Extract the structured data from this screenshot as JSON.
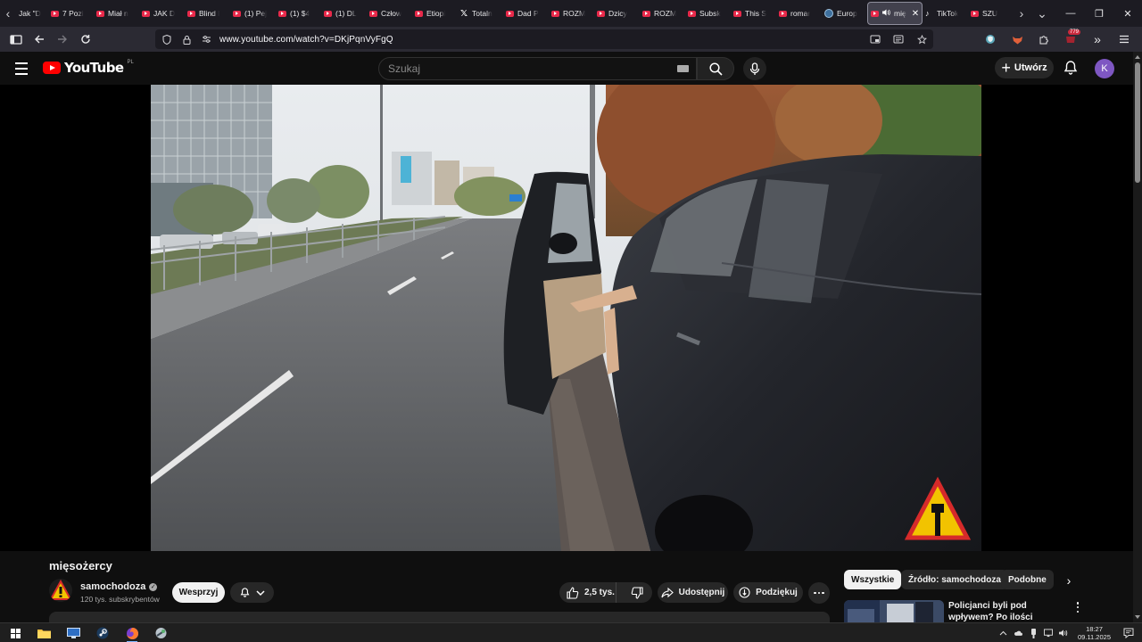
{
  "browser": {
    "tabs": [
      {
        "title": "Jak \"D",
        "icon": "tab-arrow-icon"
      },
      {
        "title": "7 Pozi",
        "icon": "youtube-favicon"
      },
      {
        "title": "Miał n",
        "icon": "youtube-favicon"
      },
      {
        "title": "JAK D",
        "icon": "youtube-favicon"
      },
      {
        "title": "Blind l",
        "icon": "youtube-favicon"
      },
      {
        "title": "(1) Pej",
        "icon": "youtube-favicon"
      },
      {
        "title": "(1) $4",
        "icon": "youtube-favicon"
      },
      {
        "title": "(1) DL",
        "icon": "youtube-favicon"
      },
      {
        "title": "Człow",
        "icon": "youtube-favicon"
      },
      {
        "title": "Etiopi",
        "icon": "youtube-favicon"
      },
      {
        "title": "Totaln",
        "icon": "x-favicon"
      },
      {
        "title": "Dad P",
        "icon": "youtube-favicon"
      },
      {
        "title": "ROZM",
        "icon": "youtube-favicon"
      },
      {
        "title": "Dzicy",
        "icon": "youtube-favicon"
      },
      {
        "title": "ROZM",
        "icon": "youtube-favicon"
      },
      {
        "title": "Subsk",
        "icon": "youtube-favicon"
      },
      {
        "title": "This S",
        "icon": "youtube-favicon"
      },
      {
        "title": "romar",
        "icon": "youtube-favicon"
      },
      {
        "title": "Europ",
        "icon": "globe-favicon"
      }
    ],
    "active_tab": {
      "title": "mię",
      "icon": "youtube-favicon"
    },
    "tabs_after": [
      {
        "title": "TikTok",
        "icon": "tiktok-favicon"
      },
      {
        "title": "SZU",
        "icon": "youtube-favicon"
      }
    ],
    "url": "www.youtube.com/watch?v=DKjPqnVyFgQ",
    "extension_badge": "779",
    "accent_color": "#e8294a"
  },
  "youtube": {
    "logo_text": "YouTube",
    "country_code": "PL",
    "search_placeholder": "Szukaj",
    "create_label": "Utwórz",
    "avatar_letter": "K",
    "avatar_color": "#7e57c2",
    "video": {
      "title": "mięsożercy",
      "channel_name": "samochodoza",
      "subscribers": "120 tys. subskrybentów",
      "support_label": "Wesprzyj",
      "like_count": "2,5 tys.",
      "share_label": "Udostępnij",
      "thanks_label": "Podziękuj"
    },
    "chips": [
      "Wszystkie",
      "Źródło: samochodoza",
      "Podobne"
    ],
    "related": [
      {
        "title": "Policjanci byli pod wpływem? Po ilości zaniedbań, kłamstw..."
      }
    ]
  },
  "taskbar": {
    "time": "18:27",
    "date": "09.11.2025",
    "apps": [
      "windows-start-icon",
      "file-explorer-icon",
      "remote-desktop-icon",
      "steam-icon",
      "firefox-icon",
      "app-icon"
    ]
  }
}
